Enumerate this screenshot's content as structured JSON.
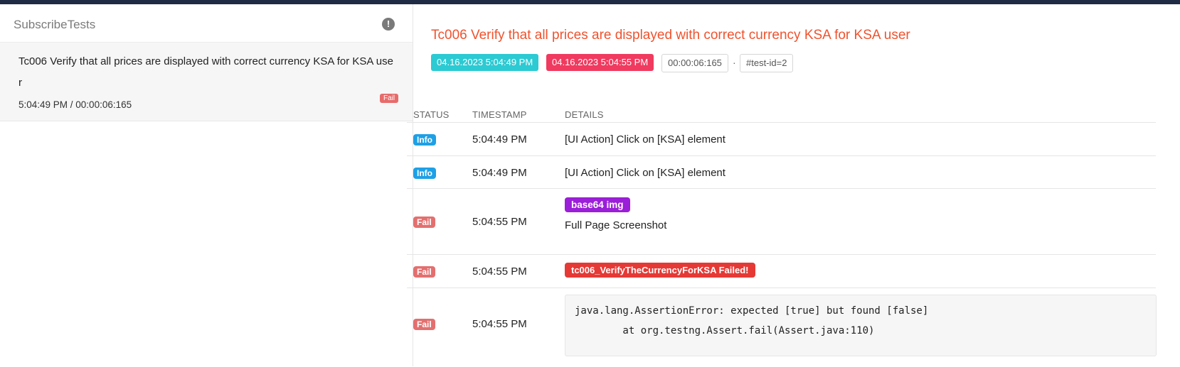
{
  "left": {
    "title": "SubscribeTests",
    "warning_icon": "exclamation-circle-icon",
    "test": {
      "name": "Tc006 Verify that all prices are displayed with correct currency KSA for KSA user",
      "time": "5:04:49 PM / 00:00:06:165",
      "status": "Fail"
    }
  },
  "detail": {
    "title": "Tc006 Verify that all prices are displayed with correct currency KSA for KSA user",
    "start": "04.16.2023 5:04:49 PM",
    "end": "04.16.2023 5:04:55 PM",
    "duration": "00:00:06:165",
    "separator": "·",
    "test_id": "#test-id=2"
  },
  "table": {
    "headers": {
      "status": "STATUS",
      "timestamp": "TIMESTAMP",
      "details": "DETAILS"
    },
    "rows": [
      {
        "status": "Info",
        "time": "5:04:49 PM",
        "details": "[UI Action] Click on [KSA] element"
      },
      {
        "status": "Info",
        "time": "5:04:49 PM",
        "details": "[UI Action] Click on [KSA] element"
      },
      {
        "status": "Fail",
        "time": "5:04:55 PM",
        "tag": "base64 img",
        "details": "Full Page Screenshot"
      },
      {
        "status": "Fail",
        "time": "5:04:55 PM",
        "tag": "tc006_VerifyTheCurrencyForKSA Failed!"
      },
      {
        "status": "Fail",
        "time": "5:04:55 PM",
        "trace_line1": "java.lang.AssertionError: expected [true] but found [false]",
        "trace_line2": "        at org.testng.Assert.fail(Assert.java:110)"
      }
    ]
  },
  "colors": {
    "title": "#f0522d",
    "start_chip": "#2ccad3",
    "end_chip": "#f03a5f",
    "info_badge": "#1ea0e6",
    "fail_badge": "#e46f6f",
    "base64_tag": "#9b1ed8",
    "failed_tag": "#e53935"
  }
}
